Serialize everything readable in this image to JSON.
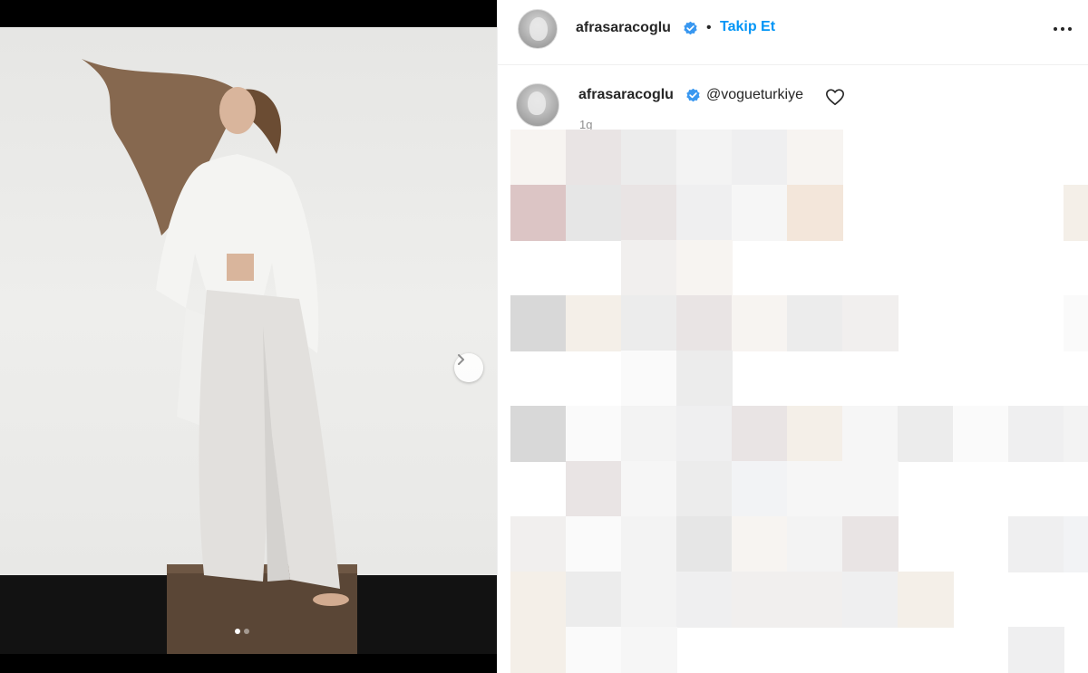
{
  "post": {
    "author": "afrasaracoglu",
    "follow_label": "Takip Et",
    "separator": "•",
    "caption_author": "afrasaracoglu",
    "mention": "@vogueturkiye",
    "timestamp": "1g"
  },
  "carousel": {
    "slide_count": 2,
    "active_index": 0
  },
  "icons": {
    "verified": "verified-badge-icon",
    "more": "more-options-icon",
    "heart": "heart-icon",
    "next": "chevron-right-icon"
  },
  "colors": {
    "accent": "#0095f6",
    "verified": "#3897f0",
    "text": "#262626",
    "muted": "#8e8e8e"
  }
}
